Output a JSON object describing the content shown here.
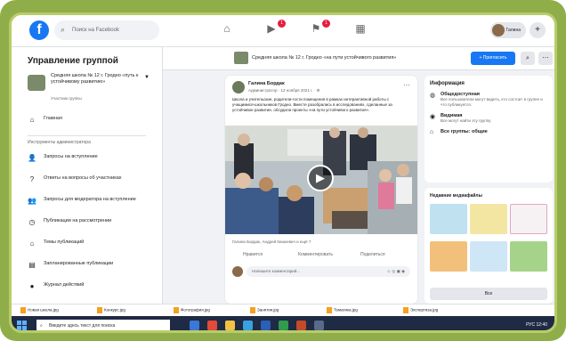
{
  "topbar": {
    "logo": "f",
    "search_placeholder": "Поиск на Facebook",
    "notif_badge": "1",
    "messages_badge": "1",
    "user_name": "Галина",
    "plus": "+",
    "bell": "🔔"
  },
  "sidebar": {
    "title": "Управление группой",
    "group_name": "Средняя школа № 12 г. Гродно «путь к устойчивому развитию»",
    "group_sub": "Участник группы",
    "home_label": "Главная",
    "section_label": "Инструменты администратора",
    "items": [
      {
        "label": "Запросы на вступление",
        "icon": "person-icon"
      },
      {
        "label": "Ответы на вопросы об участниках",
        "icon": "question-icon"
      },
      {
        "label": "Запросы для модератора на вступление",
        "icon": "people-icon"
      },
      {
        "label": "Публикации на рассмотрении",
        "icon": "clock-icon"
      },
      {
        "label": "Темы публикаций",
        "icon": "tag-icon"
      },
      {
        "label": "Запланированные публикации",
        "icon": "calendar-icon"
      },
      {
        "label": "Журнал действий",
        "icon": "log-icon"
      }
    ]
  },
  "group_header": {
    "title": "Средняя школа № 12 г. Гродно «на пути устойчивого развития»",
    "invite_label": "+ Пригласить",
    "search_glyph": "⌕",
    "more_glyph": "⋯"
  },
  "post": {
    "author": "Галина Бордак",
    "meta": "Администратор · 12 ноября 2021 г. · ⚙",
    "text": "Школа и учительские, родители-гости помещения в рамках интерактивной работы с учащимися-школьников Гродно. Вместе разобрались в исследованиях, сделанные за устойчивое развитие, обсудили проекты «на пути устойчивого развития».",
    "reactions": "Галина Бордак, Андрей Кишкевич и ещё 7",
    "like_label": "Нравится",
    "comment_label": "Комментировать",
    "share_label": "Поделиться",
    "comment_placeholder": "Напишите комментарий...",
    "comment_icons": "☺ ◎ ▣ ◉"
  },
  "info": {
    "heading": "Информация",
    "rows": [
      {
        "title": "Общедоступная",
        "desc": "Все пользователи могут видеть, кто состоит в группе и что публикуется.",
        "icon": "globe-icon"
      },
      {
        "title": "Видимая",
        "desc": "Все могут найти эту группу.",
        "icon": "eye-icon"
      },
      {
        "title": "Все группы: общие",
        "desc": "",
        "icon": "tag-icon"
      }
    ]
  },
  "media": {
    "heading": "Недавние медиафайлы",
    "all_label": "Все"
  },
  "downloads": [
    "Новая школа.jpg",
    "Конкурс.jpg",
    "Фотография.jpg",
    "Занятия.jpg",
    "Тематика.jpg",
    "Экспертиза.jpg"
  ],
  "taskbar": {
    "search_placeholder": "Введите здесь текст для поиска",
    "tray": "РУС  12:40"
  },
  "colors": {
    "brand": "#1877f2",
    "frame": "#8fae4a",
    "badge": "#e41e3f"
  }
}
